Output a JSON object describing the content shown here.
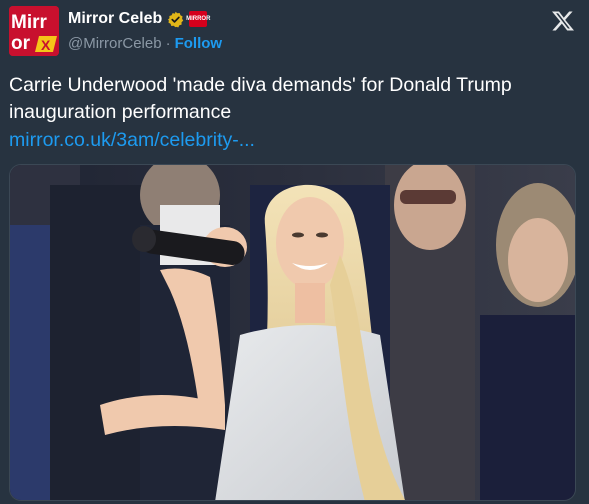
{
  "account": {
    "display_name": "Mirror Celeb",
    "handle": "@MirrorCeleb",
    "separator": "·",
    "follow_label": "Follow",
    "avatar_label": "Mirror",
    "affiliate_label": "MIRROR"
  },
  "tweet": {
    "text": "Carrie Underwood 'made diva demands' for Donald Trump inauguration performance",
    "link": "mirror.co.uk/3am/celebrity-..."
  },
  "icons": {
    "verified": "verified-badge-icon",
    "affiliate": "affiliate-badge-icon",
    "platform": "x-logo-icon"
  },
  "colors": {
    "background": "#273340",
    "link": "#1d9bf0",
    "secondary_text": "#8b98a5",
    "verified_gold": "#e2b719",
    "brand_red": "#c8102e"
  }
}
